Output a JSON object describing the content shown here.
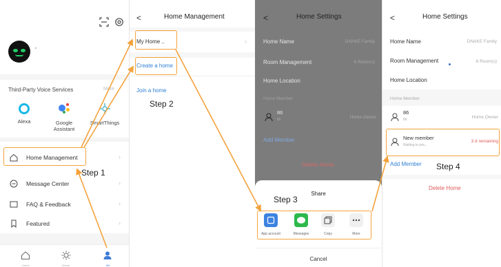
{
  "panel1": {
    "user_name": "·",
    "voice_services": {
      "title": "Third-Party Voice Services",
      "more_label": "More",
      "items": [
        {
          "label": "Alexa",
          "icon": "alexa-icon"
        },
        {
          "label": "Google\nAssistant",
          "icon": "google-assistant-icon"
        },
        {
          "label": "SmartThings",
          "icon": "smartthings-icon"
        }
      ]
    },
    "menu": [
      {
        "label": "Home Management",
        "icon": "home-icon"
      },
      {
        "label": "Message Center",
        "icon": "message-icon"
      },
      {
        "label": "FAQ & Feedback",
        "icon": "feedback-icon"
      },
      {
        "label": "Featured",
        "icon": "bookmark-icon"
      }
    ],
    "tabs": [
      {
        "label": "Home",
        "icon": "home-tab-icon"
      },
      {
        "label": "Scene",
        "icon": "sun-icon"
      },
      {
        "label": "Me",
        "icon": "person-icon"
      }
    ]
  },
  "panel2": {
    "back": "<",
    "title": "Home Management",
    "home_item": "My Home ..",
    "create_home": "Create a home",
    "join_home": "Join a home"
  },
  "panel3": {
    "back": "<",
    "title": "Home Settings",
    "home_name_label": "Home Name",
    "home_name_value": "DNAKE Family",
    "room_mgmt_label": "Room Management",
    "room_mgmt_value": "6 Room(s)",
    "location_label": "Home Location",
    "member_section": "Home Member",
    "member_name": "86",
    "member_sub": "86",
    "member_role": "Home Owner",
    "add_member": "Add Member",
    "delete_home": "Delete Home",
    "share": {
      "title": "Share",
      "options": [
        {
          "label": "App account",
          "icon": "app-account-icon"
        },
        {
          "label": "Messages",
          "icon": "messages-icon"
        },
        {
          "label": "Copy",
          "icon": "copy-icon"
        },
        {
          "label": "More",
          "icon": "more-icon"
        }
      ],
      "cancel": "Cancel"
    }
  },
  "panel4": {
    "back": "<",
    "title": "Home Settings",
    "home_name_label": "Home Name",
    "home_name_value": "DNAKE Family",
    "room_mgmt_label": "Room Management",
    "room_mgmt_value": "6 Room(s)",
    "location_label": "Home Location",
    "member_section": "Home Member",
    "member_name": "86",
    "member_sub": "86",
    "member_role": "Home Owner",
    "new_member_name": "New member",
    "new_member_sub": "Waiting to join...",
    "new_member_status": "3 d remaining",
    "add_member": "Add Member",
    "delete_home": "Delete Home"
  },
  "steps": {
    "step1": "Step 1",
    "step2": "Step 2",
    "step3": "Step 3",
    "step4": "Step 4"
  },
  "colors": {
    "highlight": "#f4a23b",
    "link": "#2f7fd6",
    "danger": "#e05a5a"
  }
}
